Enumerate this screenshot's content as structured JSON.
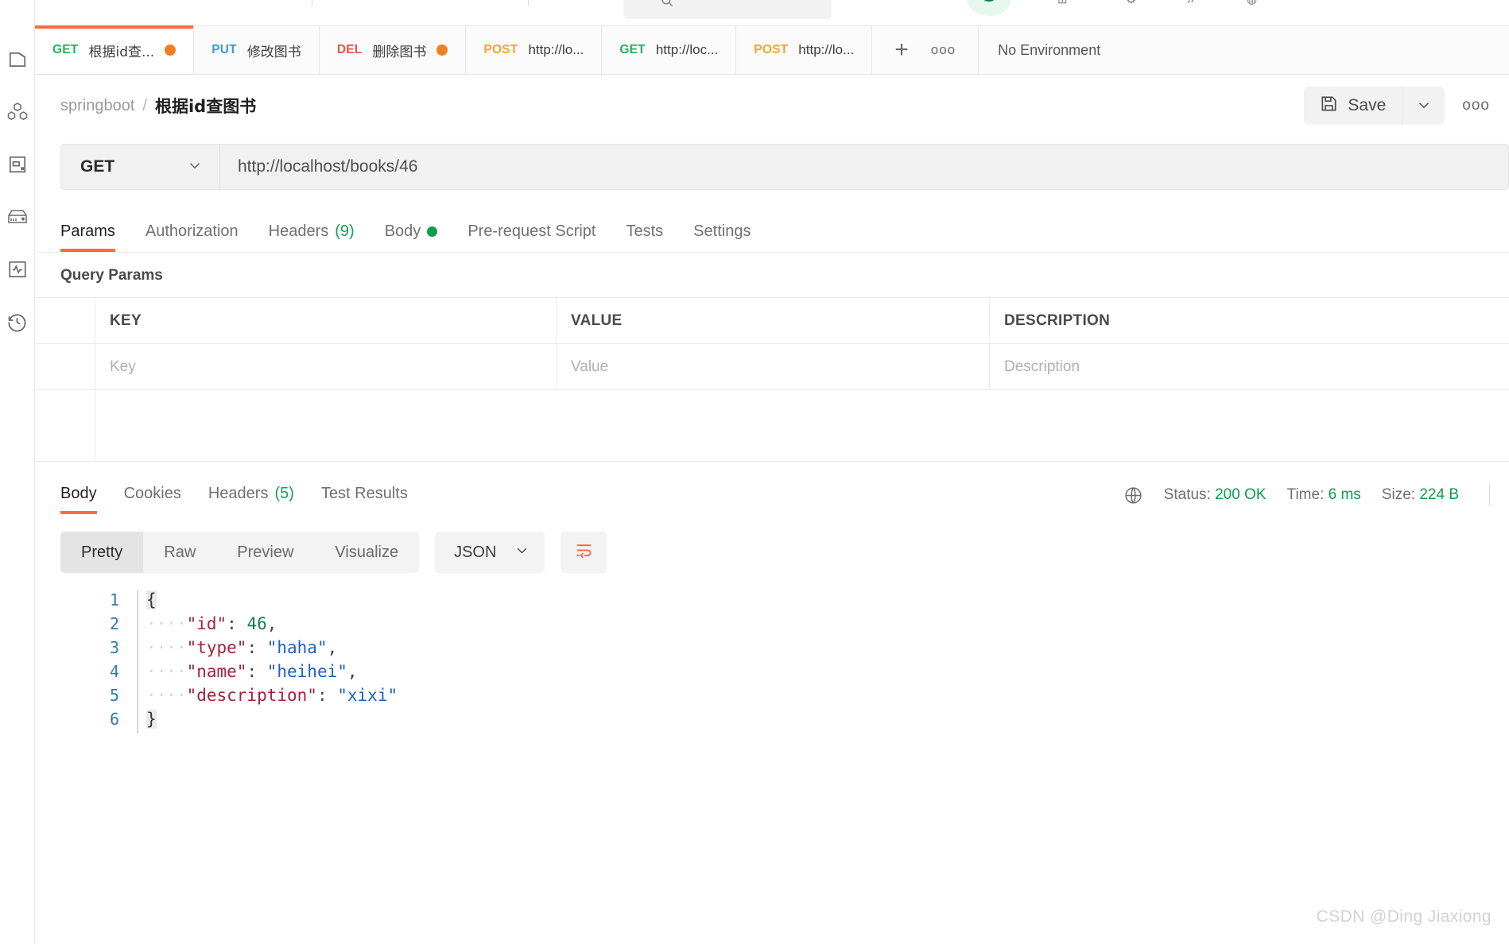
{
  "sidebar": {
    "items": [
      {
        "name": "collections",
        "icon": "file-icon"
      },
      {
        "name": "apis",
        "icon": "hexagons-icon"
      },
      {
        "name": "environments",
        "icon": "box-icon"
      },
      {
        "name": "mock-servers",
        "icon": "server-icon"
      },
      {
        "name": "monitors",
        "icon": "pulse-icon"
      },
      {
        "name": "history",
        "icon": "clock-icon"
      }
    ]
  },
  "tabbar": {
    "tabs": [
      {
        "verb": "GET",
        "verb_class": "get",
        "title": "根据id查...",
        "unsaved": true,
        "active": true
      },
      {
        "verb": "PUT",
        "verb_class": "put",
        "title": "修改图书",
        "unsaved": false,
        "active": false
      },
      {
        "verb": "DEL",
        "verb_class": "del",
        "title": "删除图书",
        "unsaved": true,
        "active": false
      },
      {
        "verb": "POST",
        "verb_class": "post",
        "title": "http://lo...",
        "unsaved": false,
        "active": false
      },
      {
        "verb": "GET",
        "verb_class": "get",
        "title": "http://loc...",
        "unsaved": false,
        "active": false
      },
      {
        "verb": "POST",
        "verb_class": "post",
        "title": "http://lo...",
        "unsaved": false,
        "active": false
      }
    ],
    "new_tab_label": "+",
    "more_label": "ooo",
    "environment_label": "No Environment"
  },
  "breadcrumb": {
    "collection": "springboot",
    "separator": "/",
    "request_name": "根据id查图书"
  },
  "toolbar": {
    "save_label": "Save",
    "more_label": "ooo"
  },
  "request": {
    "method": "GET",
    "url": "http://localhost/books/46",
    "tabs": [
      {
        "label": "Params",
        "active": true,
        "count": "",
        "dot": false
      },
      {
        "label": "Authorization",
        "active": false,
        "count": "",
        "dot": false
      },
      {
        "label": "Headers",
        "active": false,
        "count": "(9)",
        "dot": false
      },
      {
        "label": "Body",
        "active": false,
        "count": "",
        "dot": true
      },
      {
        "label": "Pre-request Script",
        "active": false,
        "count": "",
        "dot": false
      },
      {
        "label": "Tests",
        "active": false,
        "count": "",
        "dot": false
      },
      {
        "label": "Settings",
        "active": false,
        "count": "",
        "dot": false
      }
    ],
    "query_params": {
      "title": "Query Params",
      "columns": [
        "KEY",
        "VALUE",
        "DESCRIPTION"
      ],
      "rows": [
        {
          "key": "Key",
          "value": "Value",
          "description": "Description"
        }
      ]
    }
  },
  "response": {
    "tabs": [
      {
        "label": "Body",
        "active": true,
        "count": ""
      },
      {
        "label": "Cookies",
        "active": false,
        "count": ""
      },
      {
        "label": "Headers",
        "active": false,
        "count": "(5)"
      },
      {
        "label": "Test Results",
        "active": false,
        "count": ""
      }
    ],
    "status_label": "Status:",
    "status_value": "200 OK",
    "time_label": "Time:",
    "time_value": "6 ms",
    "size_label": "Size:",
    "size_value": "224 B",
    "view_modes": [
      {
        "label": "Pretty",
        "active": true
      },
      {
        "label": "Raw",
        "active": false
      },
      {
        "label": "Preview",
        "active": false
      },
      {
        "label": "Visualize",
        "active": false
      }
    ],
    "format": "JSON",
    "body_lines": [
      {
        "n": "1",
        "segments": [
          {
            "t": "{",
            "c": "tok-brace"
          }
        ]
      },
      {
        "n": "2",
        "segments": [
          {
            "t": "····",
            "c": "tok-dot"
          },
          {
            "t": "\"id\"",
            "c": "tok-key"
          },
          {
            "t": ": ",
            "c": "tok-p"
          },
          {
            "t": "46",
            "c": "tok-num"
          },
          {
            "t": ",",
            "c": "tok-p"
          }
        ]
      },
      {
        "n": "3",
        "segments": [
          {
            "t": "····",
            "c": "tok-dot"
          },
          {
            "t": "\"type\"",
            "c": "tok-key"
          },
          {
            "t": ": ",
            "c": "tok-p"
          },
          {
            "t": "\"haha\"",
            "c": "tok-str"
          },
          {
            "t": ",",
            "c": "tok-p"
          }
        ]
      },
      {
        "n": "4",
        "segments": [
          {
            "t": "····",
            "c": "tok-dot"
          },
          {
            "t": "\"name\"",
            "c": "tok-key"
          },
          {
            "t": ": ",
            "c": "tok-p"
          },
          {
            "t": "\"heihei\"",
            "c": "tok-str"
          },
          {
            "t": ",",
            "c": "tok-p"
          }
        ]
      },
      {
        "n": "5",
        "segments": [
          {
            "t": "····",
            "c": "tok-dot"
          },
          {
            "t": "\"description\"",
            "c": "tok-key"
          },
          {
            "t": ": ",
            "c": "tok-p"
          },
          {
            "t": "\"xixi\"",
            "c": "tok-str"
          }
        ]
      },
      {
        "n": "6",
        "segments": [
          {
            "t": "}",
            "c": "tok-brace"
          }
        ]
      }
    ]
  },
  "watermark": "CSDN @Ding Jiaxiong",
  "colors": {
    "accent": "#ff6c37",
    "get": "#2eae5f",
    "put": "#3a9bdc",
    "del": "#e8554c",
    "post": "#f5a623",
    "success": "#0a9e4c"
  }
}
